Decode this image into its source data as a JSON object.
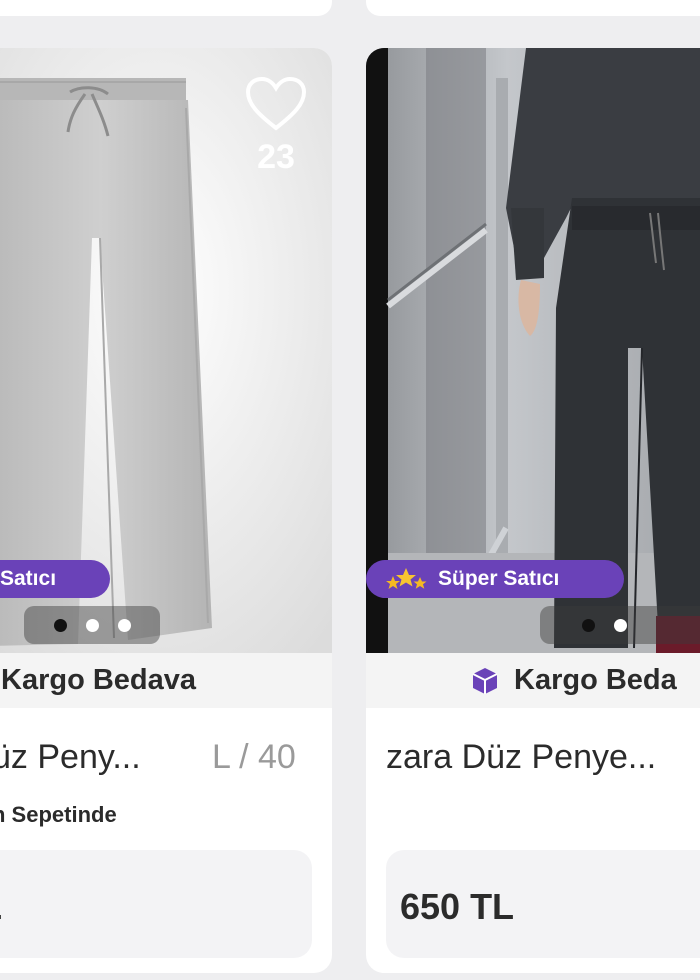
{
  "cards": [
    {
      "badge_label": "Satıcı",
      "like_count": "23",
      "carousel": {
        "count": 3,
        "active": 1
      },
      "shipping_label": "Kargo Bedava",
      "title": "üz Peny...",
      "size": "L / 40",
      "subtext": "n Sepetinde",
      "price": "L"
    },
    {
      "badge_label": "Süper Satıcı",
      "carousel": {
        "count": 2,
        "active": 1
      },
      "shipping_label": "Kargo Beda",
      "title": "zara Düz Penye...",
      "price": "650 TL"
    }
  ],
  "colors": {
    "badge": "#6a42b8",
    "background": "#eeeef0",
    "card": "#ffffff"
  },
  "icons": [
    "heart-icon",
    "stars-icon",
    "box-icon"
  ]
}
